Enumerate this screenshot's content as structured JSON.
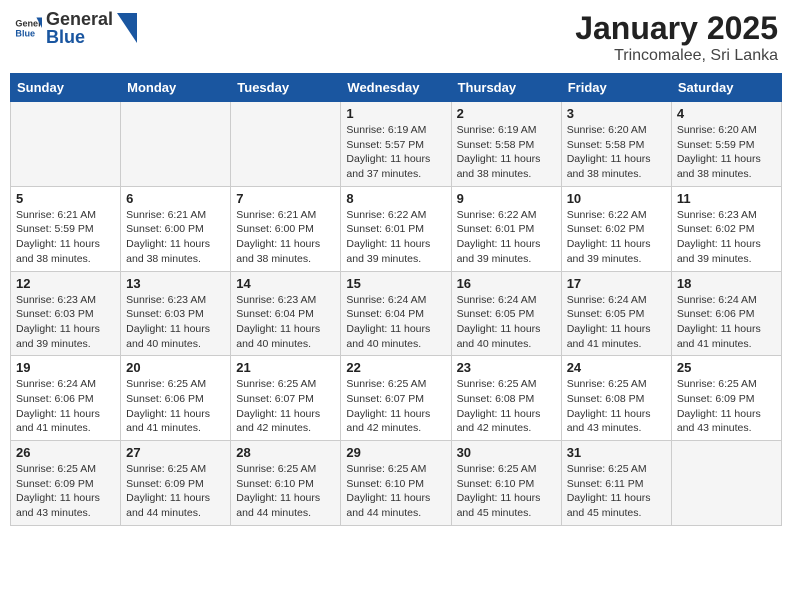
{
  "header": {
    "logo_general": "General",
    "logo_blue": "Blue",
    "title": "January 2025",
    "subtitle": "Trincomalee, Sri Lanka"
  },
  "weekdays": [
    "Sunday",
    "Monday",
    "Tuesday",
    "Wednesday",
    "Thursday",
    "Friday",
    "Saturday"
  ],
  "weeks": [
    [
      {
        "day": "",
        "info": ""
      },
      {
        "day": "",
        "info": ""
      },
      {
        "day": "",
        "info": ""
      },
      {
        "day": "1",
        "info": "Sunrise: 6:19 AM\nSunset: 5:57 PM\nDaylight: 11 hours and 37 minutes."
      },
      {
        "day": "2",
        "info": "Sunrise: 6:19 AM\nSunset: 5:58 PM\nDaylight: 11 hours and 38 minutes."
      },
      {
        "day": "3",
        "info": "Sunrise: 6:20 AM\nSunset: 5:58 PM\nDaylight: 11 hours and 38 minutes."
      },
      {
        "day": "4",
        "info": "Sunrise: 6:20 AM\nSunset: 5:59 PM\nDaylight: 11 hours and 38 minutes."
      }
    ],
    [
      {
        "day": "5",
        "info": "Sunrise: 6:21 AM\nSunset: 5:59 PM\nDaylight: 11 hours and 38 minutes."
      },
      {
        "day": "6",
        "info": "Sunrise: 6:21 AM\nSunset: 6:00 PM\nDaylight: 11 hours and 38 minutes."
      },
      {
        "day": "7",
        "info": "Sunrise: 6:21 AM\nSunset: 6:00 PM\nDaylight: 11 hours and 38 minutes."
      },
      {
        "day": "8",
        "info": "Sunrise: 6:22 AM\nSunset: 6:01 PM\nDaylight: 11 hours and 39 minutes."
      },
      {
        "day": "9",
        "info": "Sunrise: 6:22 AM\nSunset: 6:01 PM\nDaylight: 11 hours and 39 minutes."
      },
      {
        "day": "10",
        "info": "Sunrise: 6:22 AM\nSunset: 6:02 PM\nDaylight: 11 hours and 39 minutes."
      },
      {
        "day": "11",
        "info": "Sunrise: 6:23 AM\nSunset: 6:02 PM\nDaylight: 11 hours and 39 minutes."
      }
    ],
    [
      {
        "day": "12",
        "info": "Sunrise: 6:23 AM\nSunset: 6:03 PM\nDaylight: 11 hours and 39 minutes."
      },
      {
        "day": "13",
        "info": "Sunrise: 6:23 AM\nSunset: 6:03 PM\nDaylight: 11 hours and 40 minutes."
      },
      {
        "day": "14",
        "info": "Sunrise: 6:23 AM\nSunset: 6:04 PM\nDaylight: 11 hours and 40 minutes."
      },
      {
        "day": "15",
        "info": "Sunrise: 6:24 AM\nSunset: 6:04 PM\nDaylight: 11 hours and 40 minutes."
      },
      {
        "day": "16",
        "info": "Sunrise: 6:24 AM\nSunset: 6:05 PM\nDaylight: 11 hours and 40 minutes."
      },
      {
        "day": "17",
        "info": "Sunrise: 6:24 AM\nSunset: 6:05 PM\nDaylight: 11 hours and 41 minutes."
      },
      {
        "day": "18",
        "info": "Sunrise: 6:24 AM\nSunset: 6:06 PM\nDaylight: 11 hours and 41 minutes."
      }
    ],
    [
      {
        "day": "19",
        "info": "Sunrise: 6:24 AM\nSunset: 6:06 PM\nDaylight: 11 hours and 41 minutes."
      },
      {
        "day": "20",
        "info": "Sunrise: 6:25 AM\nSunset: 6:06 PM\nDaylight: 11 hours and 41 minutes."
      },
      {
        "day": "21",
        "info": "Sunrise: 6:25 AM\nSunset: 6:07 PM\nDaylight: 11 hours and 42 minutes."
      },
      {
        "day": "22",
        "info": "Sunrise: 6:25 AM\nSunset: 6:07 PM\nDaylight: 11 hours and 42 minutes."
      },
      {
        "day": "23",
        "info": "Sunrise: 6:25 AM\nSunset: 6:08 PM\nDaylight: 11 hours and 42 minutes."
      },
      {
        "day": "24",
        "info": "Sunrise: 6:25 AM\nSunset: 6:08 PM\nDaylight: 11 hours and 43 minutes."
      },
      {
        "day": "25",
        "info": "Sunrise: 6:25 AM\nSunset: 6:09 PM\nDaylight: 11 hours and 43 minutes."
      }
    ],
    [
      {
        "day": "26",
        "info": "Sunrise: 6:25 AM\nSunset: 6:09 PM\nDaylight: 11 hours and 43 minutes."
      },
      {
        "day": "27",
        "info": "Sunrise: 6:25 AM\nSunset: 6:09 PM\nDaylight: 11 hours and 44 minutes."
      },
      {
        "day": "28",
        "info": "Sunrise: 6:25 AM\nSunset: 6:10 PM\nDaylight: 11 hours and 44 minutes."
      },
      {
        "day": "29",
        "info": "Sunrise: 6:25 AM\nSunset: 6:10 PM\nDaylight: 11 hours and 44 minutes."
      },
      {
        "day": "30",
        "info": "Sunrise: 6:25 AM\nSunset: 6:10 PM\nDaylight: 11 hours and 45 minutes."
      },
      {
        "day": "31",
        "info": "Sunrise: 6:25 AM\nSunset: 6:11 PM\nDaylight: 11 hours and 45 minutes."
      },
      {
        "day": "",
        "info": ""
      }
    ]
  ]
}
